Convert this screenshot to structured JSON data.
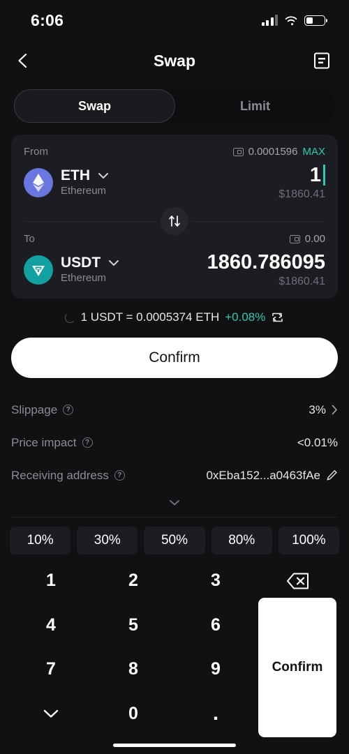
{
  "status_bar": {
    "time": "6:06",
    "signal_icon": "cellular-bars-icon",
    "wifi_icon": "wifi-icon",
    "battery_icon": "battery-icon"
  },
  "header": {
    "back_icon": "chevron-left-icon",
    "title": "Swap",
    "history_icon": "transaction-history-icon"
  },
  "tabs": [
    {
      "label": "Swap",
      "active": true
    },
    {
      "label": "Limit",
      "active": false
    }
  ],
  "swap_card": {
    "from": {
      "label": "From",
      "wallet_icon": "wallet-icon",
      "balance": "0.0001596",
      "max_label": "MAX",
      "token_symbol": "ETH",
      "token_chain": "Ethereum",
      "token_icon": "ethereum-icon",
      "chevron_icon": "chevron-down-icon",
      "amount": "1",
      "fiat": "$1860.41"
    },
    "switch_icon": "swap-direction-icon",
    "to": {
      "label": "To",
      "wallet_icon": "wallet-icon",
      "balance": "0.00",
      "token_symbol": "USDT",
      "token_chain": "Ethereum",
      "token_icon": "tether-icon",
      "chevron_icon": "chevron-down-icon",
      "amount": "1860.786095",
      "fiat": "$1860.41"
    }
  },
  "rate": {
    "loading_icon": "loading-spinner-icon",
    "text": "1 USDT = 0.0005374 ETH",
    "delta": "+0.08%",
    "flip_icon": "swap-rate-icon"
  },
  "confirm_button": {
    "label": "Confirm"
  },
  "details": {
    "rows": [
      {
        "label": "Slippage",
        "info_icon": "question-mark-icon",
        "value": "3%",
        "chevron_icon": "chevron-right-icon"
      },
      {
        "label": "Price impact",
        "info_icon": "question-mark-icon",
        "value": "<0.01%",
        "chevron_icon": ""
      },
      {
        "label": "Receiving address",
        "info_icon": "question-mark-icon",
        "value": "0xEba152...a0463fAe",
        "edit_icon": "edit-pencil-icon"
      }
    ],
    "expand_icon": "chevron-down-icon"
  },
  "percent_chips": [
    {
      "label": "10%"
    },
    {
      "label": "30%"
    },
    {
      "label": "50%"
    },
    {
      "label": "80%"
    },
    {
      "label": "100%"
    }
  ],
  "keypad": {
    "keys": [
      {
        "label": "1",
        "type": "digit"
      },
      {
        "label": "2",
        "type": "digit"
      },
      {
        "label": "3",
        "type": "digit"
      },
      {
        "label": "",
        "type": "backspace",
        "icon": "backspace-icon"
      },
      {
        "label": "4",
        "type": "digit"
      },
      {
        "label": "5",
        "type": "digit"
      },
      {
        "label": "6",
        "type": "digit"
      },
      {
        "label": "7",
        "type": "digit"
      },
      {
        "label": "8",
        "type": "digit"
      },
      {
        "label": "9",
        "type": "digit"
      },
      {
        "label": "",
        "type": "collapse",
        "icon": "chevron-down-icon"
      },
      {
        "label": "0",
        "type": "digit"
      },
      {
        "label": ".",
        "type": "decimal"
      }
    ],
    "confirm_label": "Confirm"
  },
  "colors": {
    "page_bg": "#111114",
    "card_bg": "#1c1d22",
    "accent_teal": "#2ec9b0",
    "eth_blue": "#6a77e0",
    "usdt_teal": "#12a0a0",
    "text_primary": "#ffffff",
    "text_muted": "#8b8b93"
  }
}
